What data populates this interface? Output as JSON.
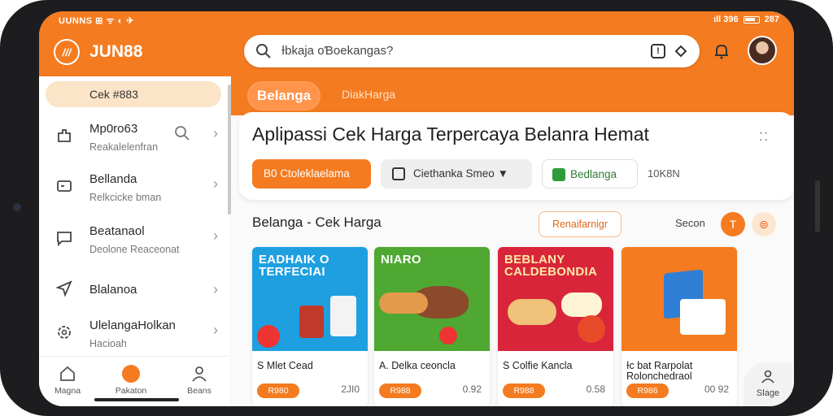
{
  "status": {
    "left": "UUNNS ⊞ ᯤ ◐ ✈",
    "right": "ıll 396",
    "battery": "287"
  },
  "header": {
    "logo_text": "///",
    "brand": "JUN88",
    "search_text": "Ɨbkaja oƁoekangas?",
    "icons": [
      "search-icon",
      "info-icon",
      "location-icon",
      "bell-icon",
      "avatar"
    ]
  },
  "sidebar": {
    "pill": "Cek #883",
    "items": [
      {
        "title": "Mp0ro63",
        "subtitle": "Reakalelenfran",
        "icon": "puzzle-icon"
      },
      {
        "title": "Bellanda",
        "subtitle": "Relkcicke bman",
        "icon": "wallet-icon"
      },
      {
        "title": "Beatanaol",
        "subtitle": "Deolone Reaceonat",
        "icon": "chat-icon"
      },
      {
        "title": "Blalanoa",
        "subtitle": "",
        "icon": "send-icon"
      },
      {
        "title": "UlelangaHolkan",
        "subtitle": "Hacioah",
        "icon": "cog-icon"
      }
    ]
  },
  "bottom_nav": [
    {
      "label": "Magna",
      "icon": "home-icon"
    },
    {
      "label": "Pakaton",
      "icon": "logo-icon"
    },
    {
      "label": "Beans",
      "icon": "user-icon"
    }
  ],
  "tabs": {
    "active": "Belanga",
    "other": "DiakHarga"
  },
  "hero": {
    "title": "Aplipassi Cek Harga Terpercaya Belanra Hemat",
    "chip_orange": "B0 Ctoleklaelama",
    "chip_gray": "Ciethanka   Smeo",
    "chip_green": "Bedlanga",
    "chip_text": "10K8N"
  },
  "section": {
    "title": "Belanga - Cek Harga",
    "filter_button": "Renaifarnigr",
    "sort_label": "Secon",
    "round_btn_1": "T",
    "round_btn_2": "⊜"
  },
  "products": [
    {
      "banner": "EADHAIK O TERFECIAI",
      "name": "S   Mlet Cead",
      "price": "R980",
      "alt_price": "2JI0",
      "bg": "#1e9fe0",
      "color": "#ffffff"
    },
    {
      "banner": "NIARO",
      "name": "A.   Delka ceoncla",
      "price": "R988",
      "alt_price": "0.92",
      "bg": "#4ea831",
      "color": "#ffffff"
    },
    {
      "banner": "BEBLANY CALDEBONDIA",
      "name": "S   Colfie Kancla",
      "price": "R988",
      "alt_price": "0.58",
      "bg": "#d9253a",
      "color": "#ffe9a8"
    },
    {
      "banner": "",
      "name": "Ɨc bat Rarpolat Rolonchedraol",
      "price": "R986",
      "alt_price": "00 92",
      "bg": "#f47b20",
      "color": "#ffffff"
    }
  ],
  "fab": {
    "label": "Slage",
    "icon": "share-icon"
  },
  "colors": {
    "accent": "#f47b20",
    "accent_light": "#fbe4c7",
    "green": "#2e9b3b"
  }
}
